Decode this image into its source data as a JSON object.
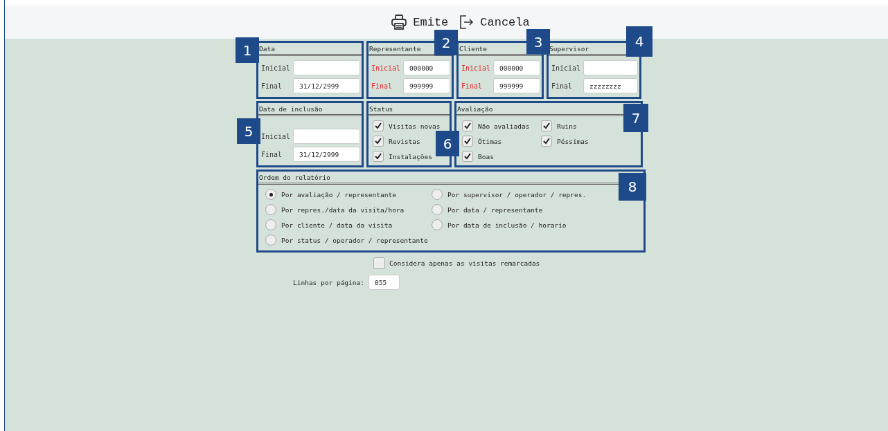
{
  "toolbar": [
    {
      "kind": "print",
      "label": "Emite"
    },
    {
      "kind": "exit",
      "label": "Cancela"
    }
  ],
  "badges": [
    "1",
    "2",
    "3",
    "4",
    "5",
    "6",
    "7",
    "8"
  ],
  "range_panels": [
    {
      "title": "Data",
      "fields": [
        {
          "label": "Inicial",
          "required": false
        },
        {
          "label": "Final",
          "value": "31/12/2999",
          "required": false
        }
      ]
    },
    {
      "title": "Representante",
      "fields": [
        {
          "label": "Inicial",
          "value": "000000",
          "required": true
        },
        {
          "label": "Final",
          "value": "999999",
          "required": true
        }
      ]
    },
    {
      "title": "Cliente",
      "fields": [
        {
          "label": "Inicial",
          "value": "000000",
          "required": true
        },
        {
          "label": "Final",
          "value": "999999",
          "required": true
        }
      ]
    },
    {
      "title": "Supervisor",
      "fields": [
        {
          "label": "Inicial",
          "required": false
        },
        {
          "label": "Final",
          "value": "zzzzzzzz",
          "required": false
        }
      ]
    }
  ],
  "inclusion_panel": {
    "title": "Data de inclusão",
    "fields": [
      {
        "label": "Inicial",
        "required": false
      },
      {
        "label": "Final",
        "value": "31/12/2999",
        "required": false
      }
    ]
  },
  "status_panel": {
    "title": "Status",
    "options": [
      {
        "label": "Visitas novas",
        "checked": true
      },
      {
        "label": "Revistas",
        "checked": true
      },
      {
        "label": "Instalações",
        "checked": true
      }
    ]
  },
  "rating_panel": {
    "title": "Avaliação",
    "options": [
      {
        "label": "Não avaliadas",
        "checked": true
      },
      {
        "label": "Ruins",
        "checked": true
      },
      {
        "label": "Ótimas",
        "checked": true
      },
      {
        "label": "Péssimas",
        "checked": true
      },
      {
        "label": "Boas",
        "checked": true
      }
    ]
  },
  "order_panel": {
    "title": "Ordem do relatório",
    "options": [
      {
        "label": "Por avaliação / representante",
        "selected": true
      },
      {
        "label": "Por supervisor / operador / repres.",
        "selected": false
      },
      {
        "label": "Por repres./data da visita/hora",
        "selected": false
      },
      {
        "label": "Por data / representante",
        "selected": false
      },
      {
        "label": "Por cliente / data da visita",
        "selected": false
      },
      {
        "label": "Por data de inclusão / horario",
        "selected": false
      },
      {
        "label": "Por status / operador / representante",
        "selected": false
      }
    ]
  },
  "rescheduled_only": {
    "label": "Considera apenas as visitas remarcadas",
    "checked": false
  },
  "lines_per_page": {
    "label": "Linhas por página:",
    "value": "055"
  }
}
